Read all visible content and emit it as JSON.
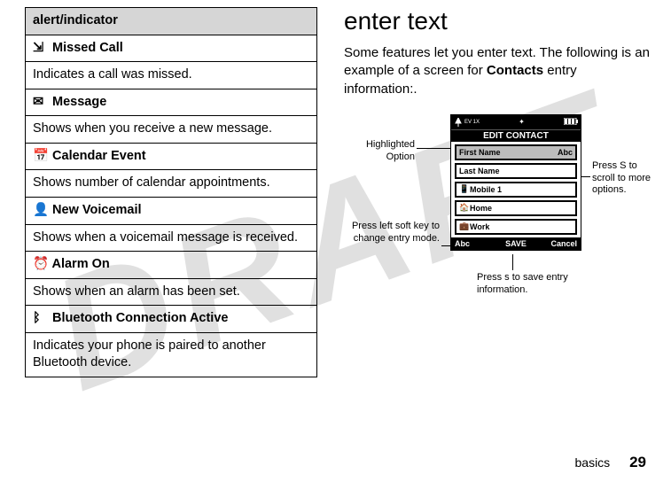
{
  "watermark": "DRAFT",
  "table": {
    "header": "alert/indicator",
    "rows": [
      {
        "icon": "⇲",
        "title": "Missed Call",
        "desc": "Indicates a call was missed.",
        "titleClass": ""
      },
      {
        "icon": "✉",
        "title": "Message",
        "desc": "Shows when you receive a new message.",
        "titleClass": ""
      },
      {
        "icon": "📅",
        "title": "Calendar Event",
        "desc": "Shows number of calendar appointments.",
        "titleClass": "narrow"
      },
      {
        "icon": "👤",
        "title": "New Voicemail",
        "desc": "Shows when a voicemail message is received.",
        "titleClass": ""
      },
      {
        "icon": "⏰",
        "title": "Alarm On",
        "desc": "Shows when an alarm has been set.",
        "titleClass": ""
      },
      {
        "icon": "ᛒ",
        "title": "Bluetooth Connection Active",
        "desc": "Indicates your phone is paired to another Bluetooth device.",
        "titleClass": ""
      }
    ]
  },
  "right": {
    "heading": "enter text",
    "intro_pre": "Some features let you enter text. The following is an example of a screen for ",
    "intro_bold": "Contacts",
    "intro_post": " entry information:."
  },
  "phone": {
    "status_left": "EV 1X",
    "title": "EDIT CONTACT",
    "fields": [
      {
        "icon": "",
        "label": "First Name",
        "mode": "Abc",
        "hl": true
      },
      {
        "icon": "",
        "label": "Last Name",
        "mode": "",
        "hl": false
      },
      {
        "icon": "📱",
        "label": "Mobile 1",
        "mode": "",
        "hl": false
      },
      {
        "icon": "🏠",
        "label": "Home",
        "mode": "",
        "hl": false
      },
      {
        "icon": "💼",
        "label": "Work",
        "mode": "",
        "hl": false
      }
    ],
    "soft_left": "Abc",
    "soft_center": "SAVE",
    "soft_right": "Cancel"
  },
  "callouts": {
    "highlighted": "Highlighted Option",
    "left_soft": "Press left soft key to change entry mode.",
    "scroll": "Press S to scroll to more options.",
    "save": "Press s to save entry information."
  },
  "footer": {
    "section": "basics",
    "page": "29"
  }
}
